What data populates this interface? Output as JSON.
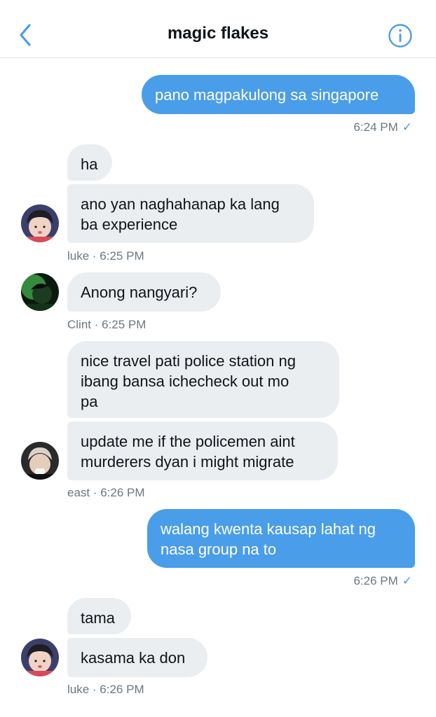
{
  "header": {
    "title": "magic flakes",
    "back_icon": "chevron-left-icon",
    "info_icon": "info-icon",
    "accent": "#4a9de9"
  },
  "messages": [
    {
      "id": "m1",
      "direction": "out",
      "text": "pano magpakulong sa singapore",
      "meta": "6:24 PM"
    },
    {
      "id": "m2",
      "direction": "in",
      "text": "ha"
    },
    {
      "id": "m3",
      "direction": "in",
      "lines": [
        "ano yan naghahanap ka lang",
        "ba experience"
      ],
      "meta": "luke · 6:25 PM",
      "sender": "luke"
    },
    {
      "id": "m4",
      "direction": "in",
      "text": "Anong nangyari?",
      "meta": "Clint · 6:25 PM",
      "sender": "Clint"
    },
    {
      "id": "m5",
      "direction": "in",
      "lines": [
        "nice travel pati police station ng",
        "ibang bansa ichecheck out mo",
        "pa"
      ]
    },
    {
      "id": "m6",
      "direction": "in",
      "lines": [
        "update me if the policemen aint",
        "murderers dyan i might migrate"
      ],
      "meta": "east · 6:26 PM",
      "sender": "east"
    },
    {
      "id": "m7",
      "direction": "out",
      "lines": [
        "walang kwenta kausap lahat ng",
        "nasa group na to"
      ],
      "meta": "6:26 PM"
    },
    {
      "id": "m8",
      "direction": "in",
      "text": "tama"
    },
    {
      "id": "m9",
      "direction": "in",
      "text": "kasama ka don",
      "meta": "luke · 6:26 PM",
      "sender": "luke"
    }
  ],
  "read_check": "✓"
}
